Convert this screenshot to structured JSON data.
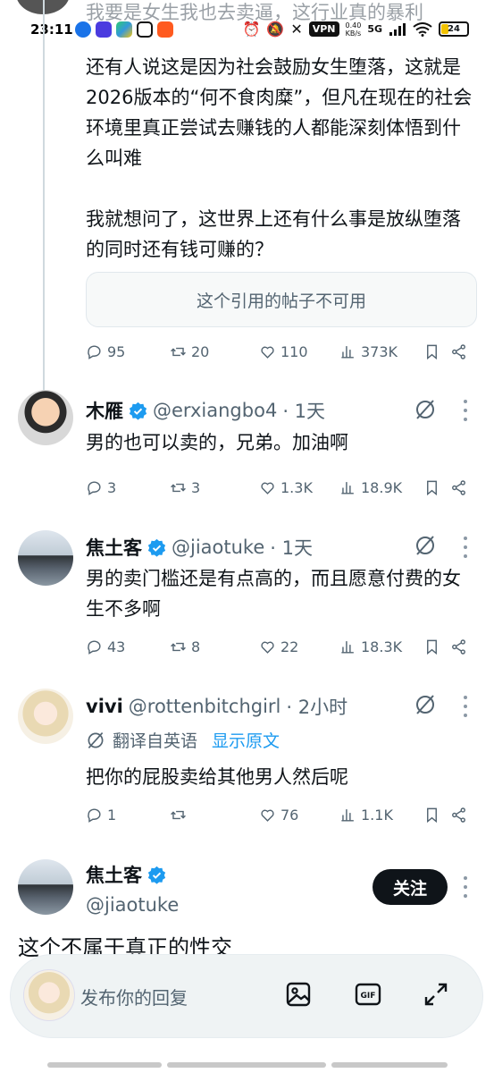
{
  "status_bar": {
    "peek_text": "我要是女生我也去卖逼，这行业真的暴利",
    "time": "23:11",
    "vpn": "VPN",
    "speed_value": "0.40",
    "speed_unit": "KB/s",
    "network": "5G",
    "battery": "24"
  },
  "post": {
    "paragraph1": "还有人说这是因为社会鼓励女生堕落，这就是2026版本的“何不食肉糜”，但凡在现在的社会环境里真正尝试去赚钱的人都能深刻体悟到什么叫难",
    "paragraph2": "我就想问了，这世界上还有什么事是放纵堕落的同时还有钱可赚的？",
    "quote_unavailable": "这个引用的帖子不可用",
    "stats": {
      "replies": "95",
      "reposts": "20",
      "likes": "110",
      "views": "373K"
    }
  },
  "replies": [
    {
      "name": "木雁",
      "handle": "@erxiangbo4",
      "time": "· 1天",
      "text": "男的也可以卖的，兄弟。加油啊",
      "stats": {
        "replies": "3",
        "reposts": "3",
        "likes": "1.3K",
        "views": "18.9K"
      }
    },
    {
      "name": "焦土客",
      "handle": "@jiaotuke",
      "time": "· 1天",
      "text": "男的卖门槛还是有点高的，而且愿意付费的女生不多啊",
      "stats": {
        "replies": "43",
        "reposts": "8",
        "likes": "22",
        "views": "18.3K"
      }
    },
    {
      "name": "vivi",
      "handle": "@rottenbitchgirl",
      "time": "· 2小时",
      "translated_from": "翻译自英语",
      "show_original": "显示原文",
      "text": "把你的屁股卖给其他男人然后呢",
      "stats": {
        "replies": "1",
        "reposts": "",
        "likes": "76",
        "views": "1.1K"
      }
    }
  ],
  "focus_tweet": {
    "name": "焦土客",
    "handle": "@jiaotuke",
    "follow_label": "关注",
    "text": "这个不属于真正的性交"
  },
  "composer": {
    "placeholder": "发布你的回复"
  },
  "colors": {
    "text": "#0f1419",
    "secondary": "#536471",
    "link": "#1d9bf0",
    "verified": "#1d9bf0"
  }
}
